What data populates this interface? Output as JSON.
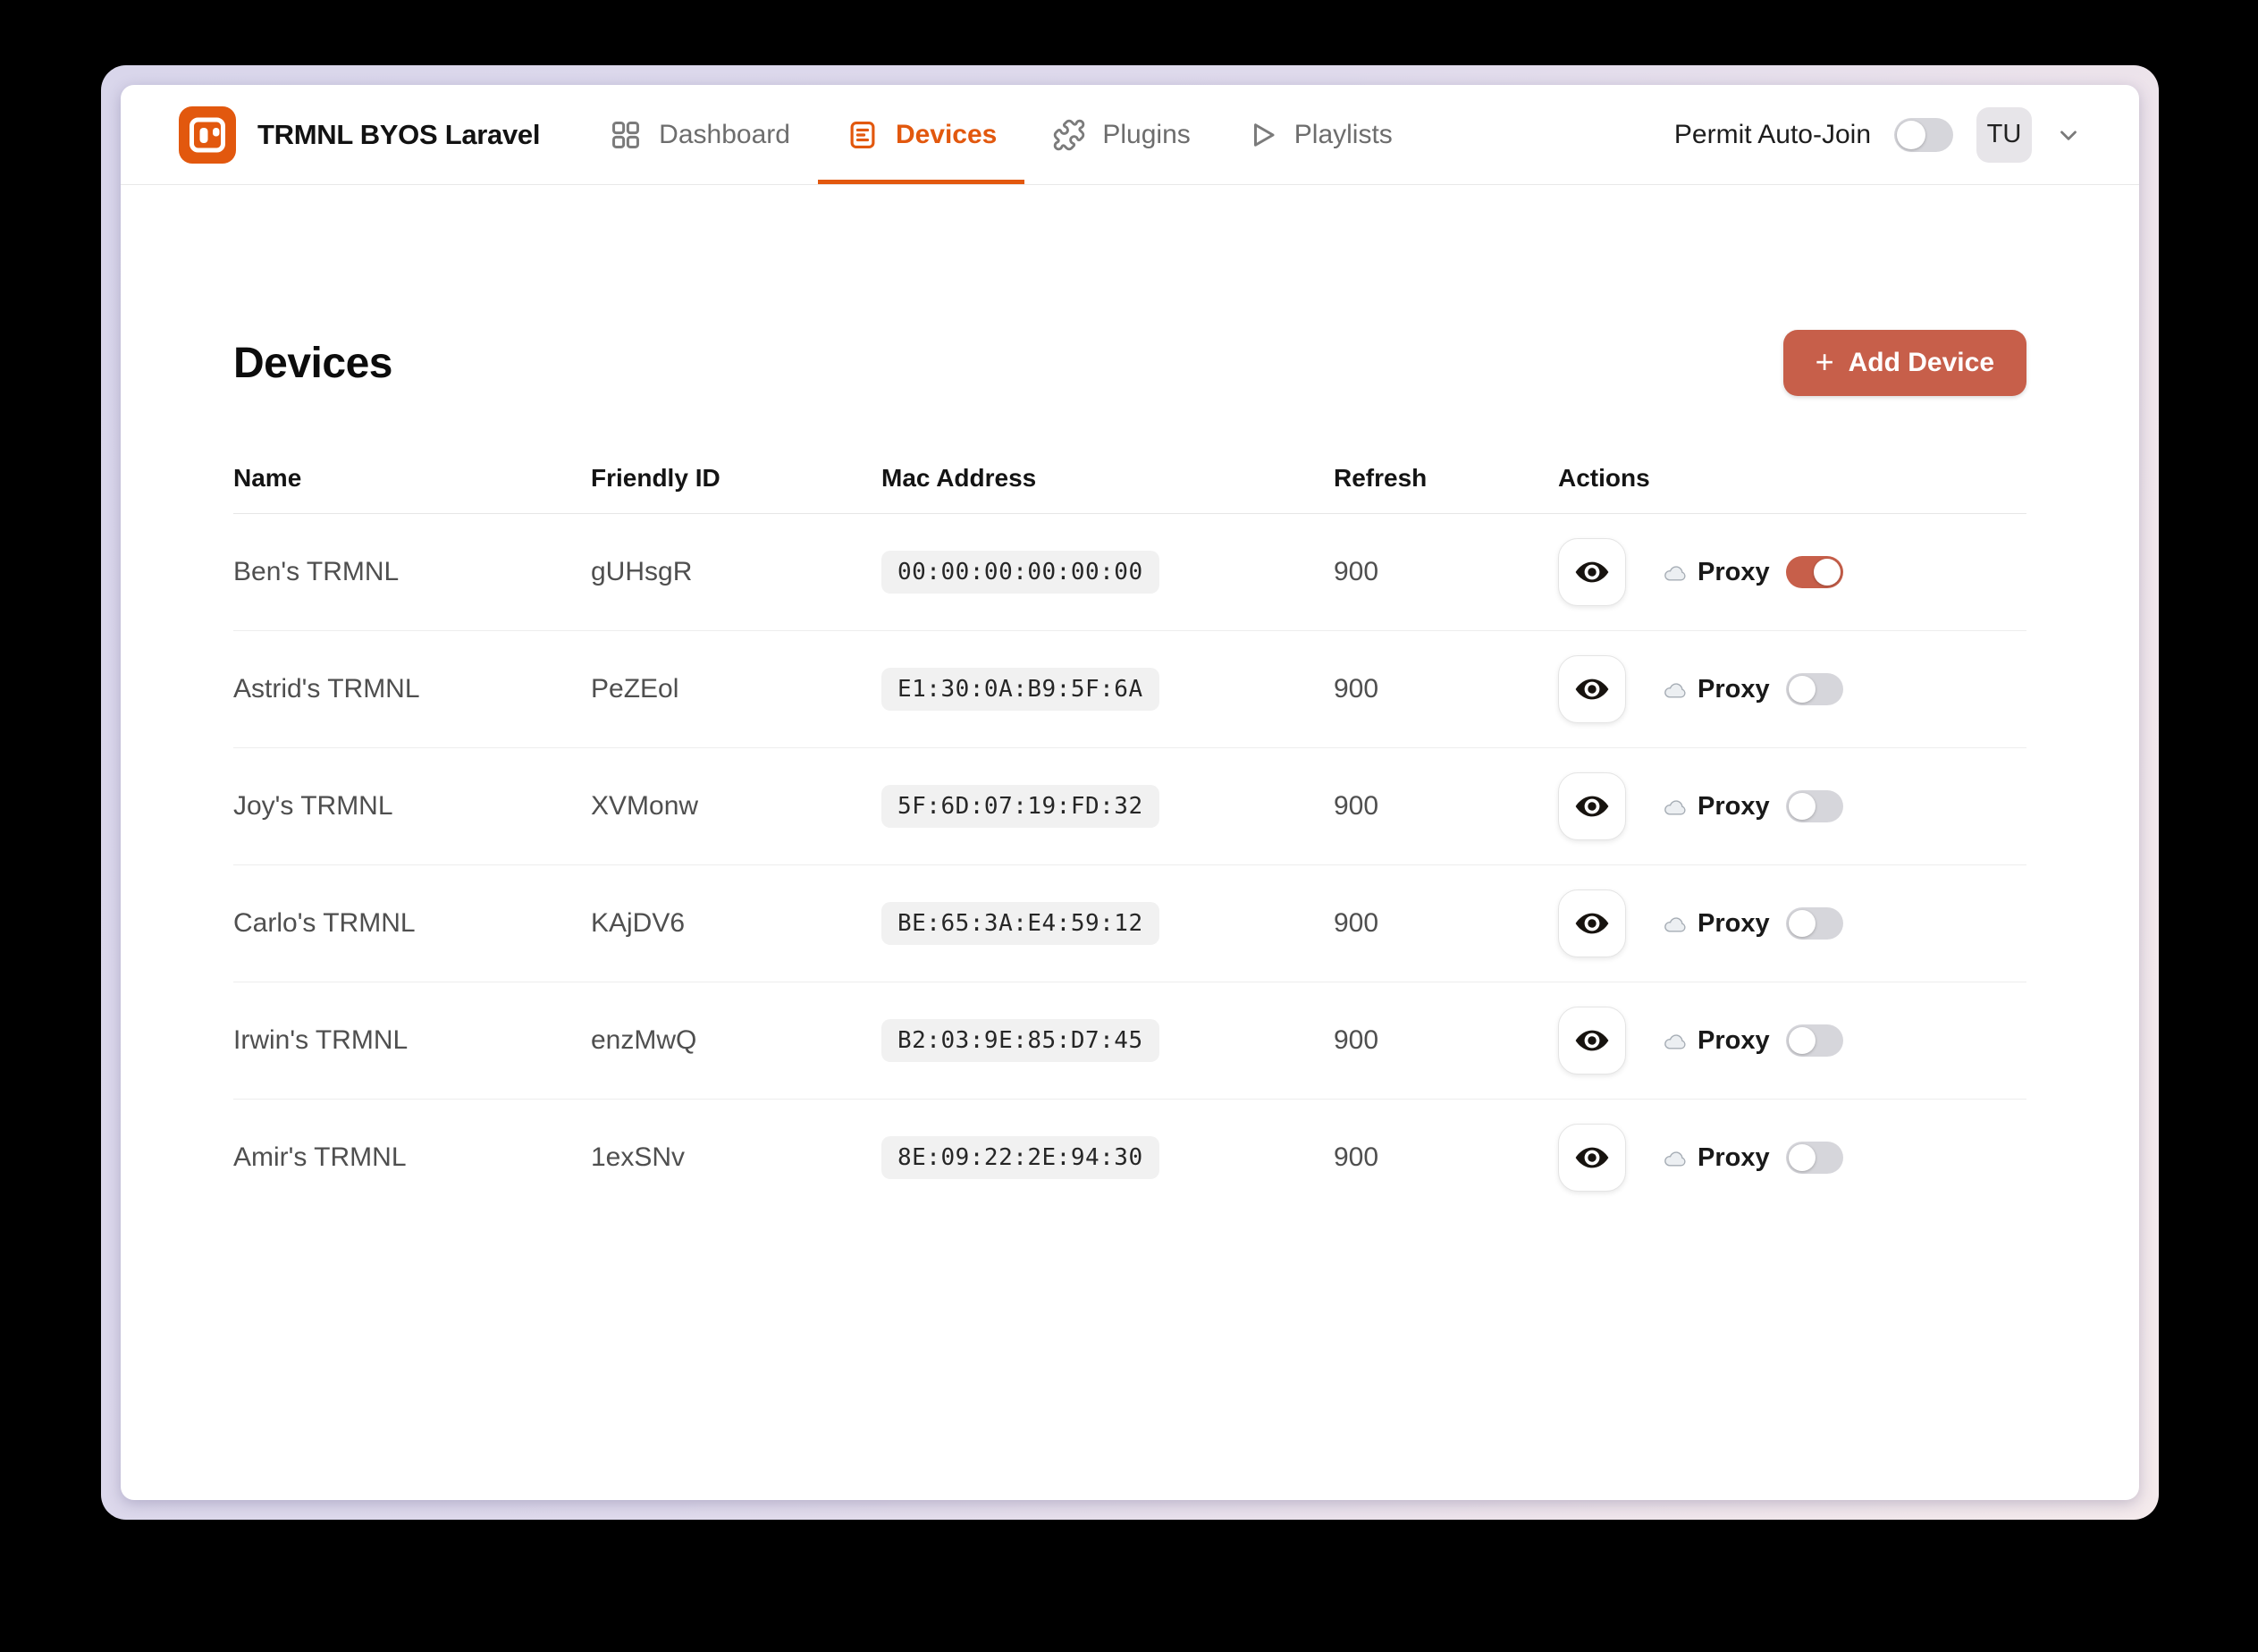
{
  "header": {
    "brand": {
      "title": "TRMNL BYOS Laravel"
    },
    "nav": [
      {
        "label": "Dashboard",
        "icon": "grid-icon",
        "active": false
      },
      {
        "label": "Devices",
        "icon": "devices-icon",
        "active": true
      },
      {
        "label": "Plugins",
        "icon": "puzzle-icon",
        "active": false
      },
      {
        "label": "Playlists",
        "icon": "play-icon",
        "active": false
      }
    ],
    "permit_auto_join": {
      "label": "Permit Auto-Join",
      "enabled": false
    },
    "user": {
      "initials": "TU"
    }
  },
  "page": {
    "title": "Devices",
    "add_button": {
      "plus": "+",
      "label": "Add Device"
    }
  },
  "table": {
    "columns": [
      "Name",
      "Friendly ID",
      "Mac Address",
      "Refresh",
      "Actions"
    ],
    "proxy_label": "Proxy",
    "rows": [
      {
        "name": "Ben's TRMNL",
        "friendly_id": "gUHsgR",
        "mac": "00:00:00:00:00:00",
        "refresh": "900",
        "proxy": true
      },
      {
        "name": "Astrid's TRMNL",
        "friendly_id": "PeZEol",
        "mac": "E1:30:0A:B9:5F:6A",
        "refresh": "900",
        "proxy": false
      },
      {
        "name": "Joy's TRMNL",
        "friendly_id": "XVMonw",
        "mac": "5F:6D:07:19:FD:32",
        "refresh": "900",
        "proxy": false
      },
      {
        "name": "Carlo's TRMNL",
        "friendly_id": "KAjDV6",
        "mac": "BE:65:3A:E4:59:12",
        "refresh": "900",
        "proxy": false
      },
      {
        "name": "Irwin's TRMNL",
        "friendly_id": "enzMwQ",
        "mac": "B2:03:9E:85:D7:45",
        "refresh": "900",
        "proxy": false
      },
      {
        "name": "Amir's TRMNL",
        "friendly_id": "1exSNv",
        "mac": "8E:09:22:2E:94:30",
        "refresh": "900",
        "proxy": false
      }
    ]
  },
  "colors": {
    "accent_orange": "#e2580e",
    "terracotta": "#c75f4a",
    "toggle_off": "#d6d6db"
  }
}
